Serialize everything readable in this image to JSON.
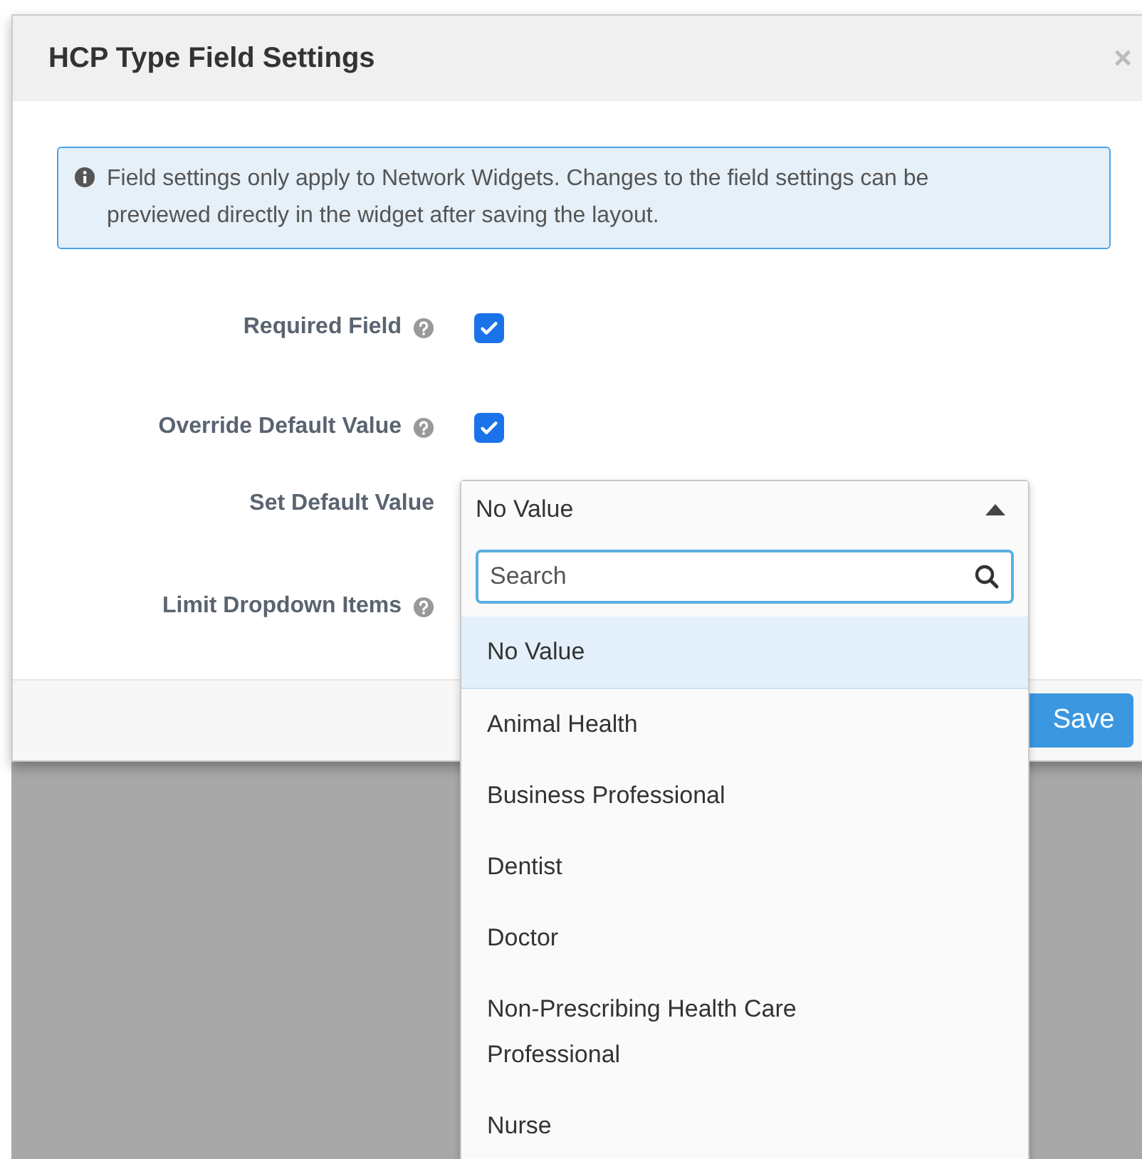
{
  "dialog": {
    "title": "HCP Type Field Settings",
    "close": "×"
  },
  "info": "Field settings only apply to Network Widgets. Changes to the field settings can be previewed directly in the widget after saving the layout.",
  "fields": [
    {
      "kind": "checkbox",
      "label": "Required Field",
      "help": true,
      "checked": true
    },
    {
      "kind": "checkbox",
      "label": "Override Default Value",
      "help": true,
      "checked": true
    },
    {
      "kind": "select",
      "label": "Set Default Value",
      "help": false,
      "value": "No Value",
      "expanded": true,
      "search": {
        "placeholder": "Search"
      },
      "options": [
        {
          "label": "No Value",
          "selected": true
        },
        {
          "label": "Animal Health",
          "selected": false
        },
        {
          "label": "Business Professional",
          "selected": false
        },
        {
          "label": "Dentist",
          "selected": false
        },
        {
          "label": "Doctor",
          "selected": false
        },
        {
          "label": "Non-Prescribing Health Care Professional",
          "selected": false
        },
        {
          "label": "Nurse",
          "selected": false
        }
      ]
    },
    {
      "kind": "hidden",
      "label": "Limit Dropdown Items",
      "help": true
    }
  ],
  "footer": {
    "buttons": [
      "Save"
    ]
  }
}
